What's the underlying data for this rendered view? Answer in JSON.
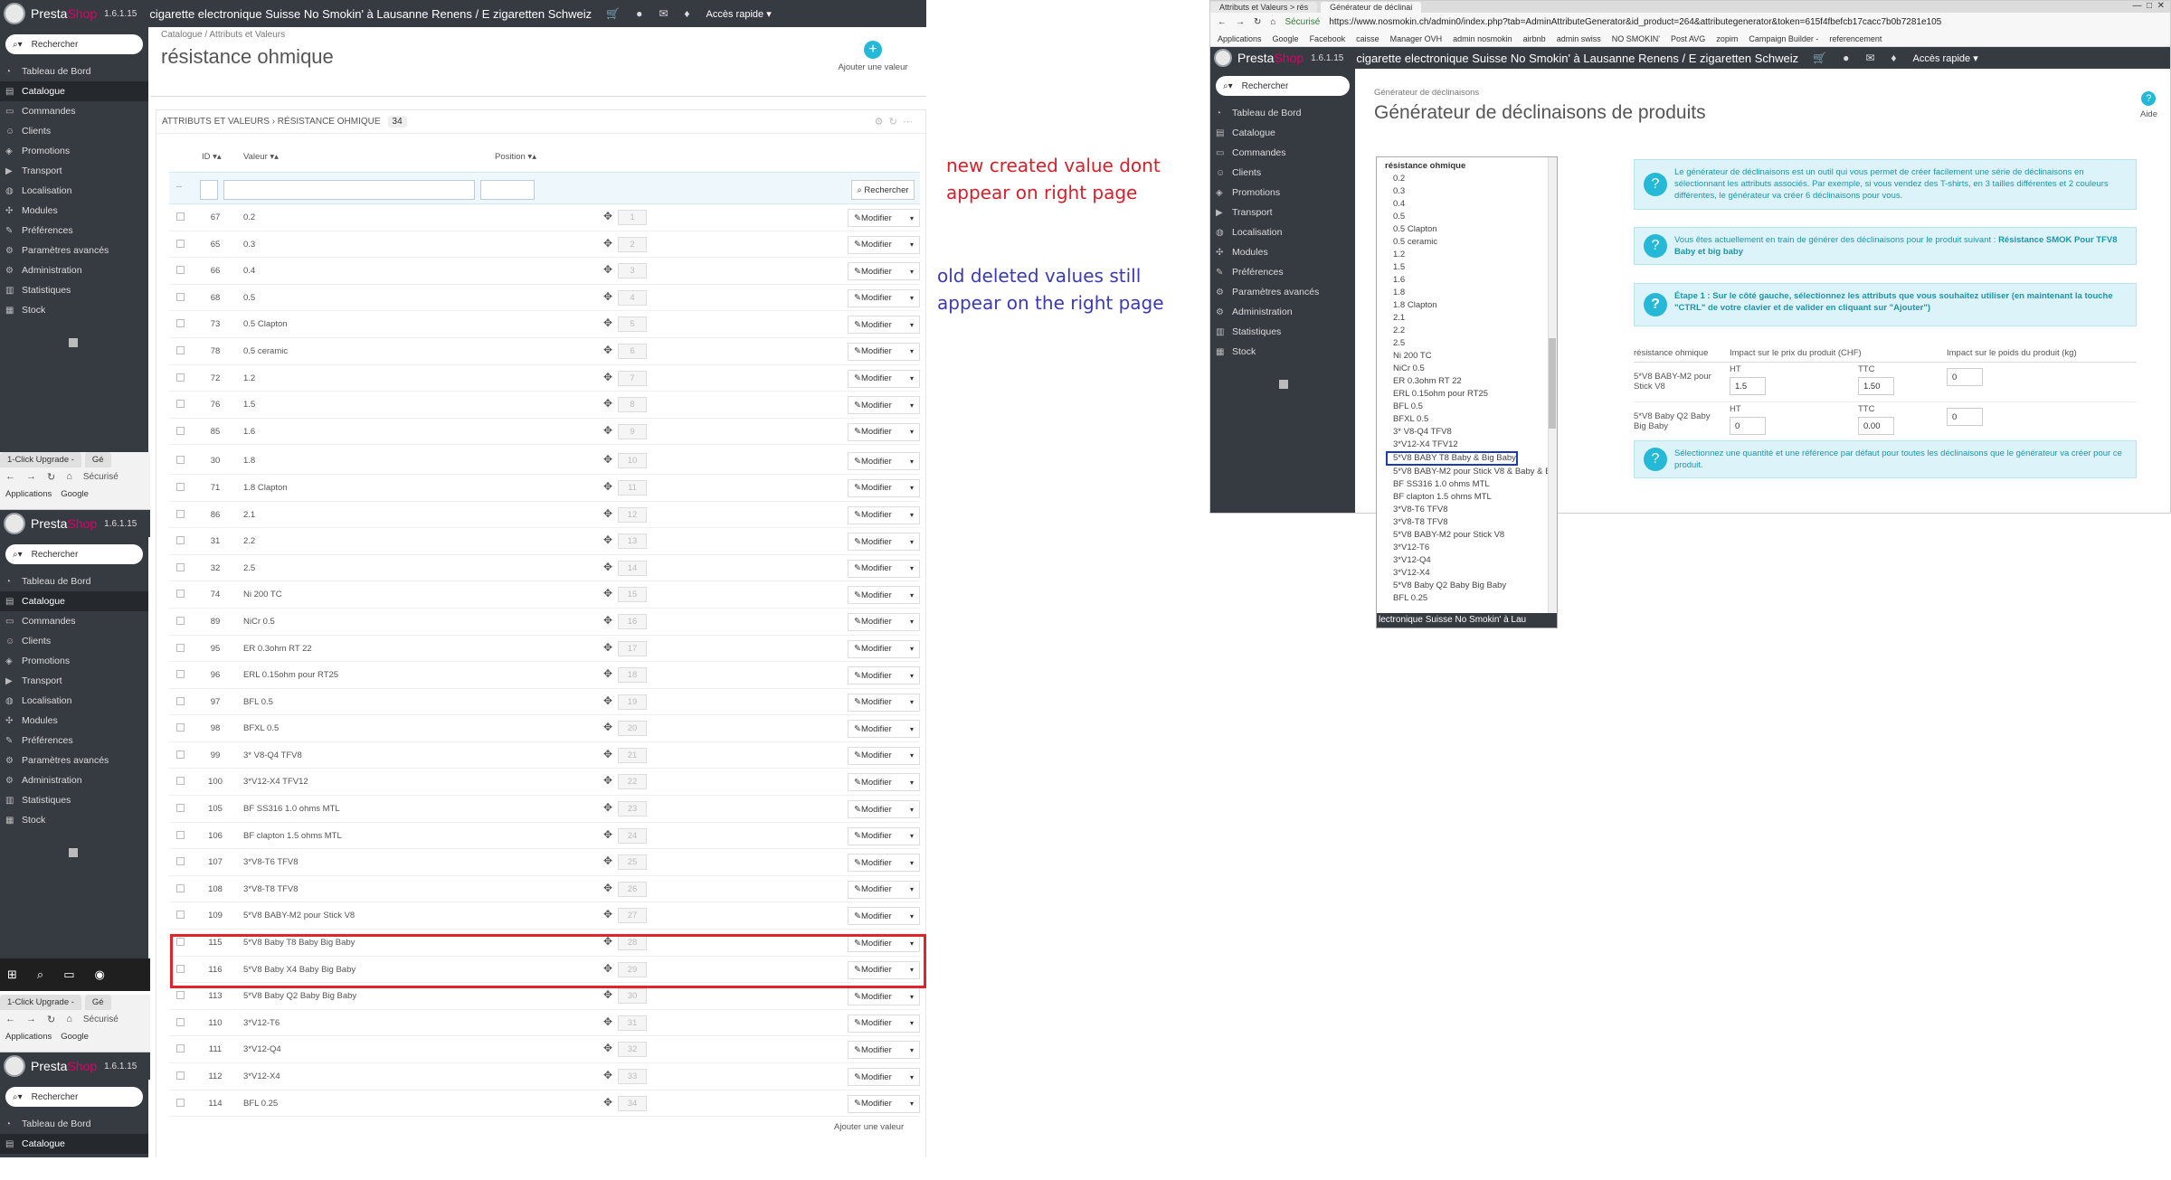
{
  "left": {
    "topbar": {
      "logo_presta": "Presta",
      "logo_shop": "Shop",
      "version": "1.6.1.15",
      "shop_name": "cigarette electronique Suisse No Smokin' à Lausanne Renens / E zigaretten Schweiz",
      "quick_access": "Accès rapide ▾"
    },
    "search_placeholder": "Rechercher",
    "menu": [
      "Tableau de Bord",
      "Catalogue",
      "Commandes",
      "Clients",
      "Promotions",
      "Transport",
      "Localisation",
      "Modules",
      "Préférences",
      "Paramètres avancés",
      "Administration",
      "Statistiques",
      "Stock"
    ],
    "browser": {
      "tab1": "1-Click Upgrade -",
      "tab2": "Gé",
      "secure": "Sécurisé",
      "apps": "Applications",
      "google": "Google"
    },
    "breadcrumb": "Catalogue  /  Attributs et Valeurs",
    "page_title": "résistance ohmique",
    "add_value_label": "Ajouter une valeur",
    "add_value_short": "A",
    "panel_title": "ATTRIBUTS ET VALEURS › RÉSISTANCE OHMIQUE",
    "count": "34",
    "columns": {
      "id": "ID ▾▴",
      "value": "Valeur ▾▴",
      "position": "Position ▾▴"
    },
    "filter_button": "Rechercher",
    "modify_label": "Modifier",
    "rows": [
      {
        "id": "67",
        "value": "0.2",
        "pos": "1"
      },
      {
        "id": "65",
        "value": "0.3",
        "pos": "2"
      },
      {
        "id": "66",
        "value": "0.4",
        "pos": "3"
      },
      {
        "id": "68",
        "value": "0.5",
        "pos": "4"
      },
      {
        "id": "73",
        "value": "0.5 Clapton",
        "pos": "5"
      },
      {
        "id": "78",
        "value": "0.5 ceramic",
        "pos": "6"
      },
      {
        "id": "72",
        "value": "1.2",
        "pos": "7"
      },
      {
        "id": "76",
        "value": "1.5",
        "pos": "8"
      },
      {
        "id": "85",
        "value": "1.6",
        "pos": "9"
      },
      {
        "id": "30",
        "value": "1.8",
        "pos": "10"
      },
      {
        "id": "71",
        "value": "1.8 Clapton",
        "pos": "11"
      },
      {
        "id": "86",
        "value": "2.1",
        "pos": "12"
      },
      {
        "id": "31",
        "value": "2.2",
        "pos": "13"
      },
      {
        "id": "32",
        "value": "2.5",
        "pos": "14"
      },
      {
        "id": "74",
        "value": "Ni 200 TC",
        "pos": "15"
      },
      {
        "id": "89",
        "value": "NiCr 0.5",
        "pos": "16"
      },
      {
        "id": "95",
        "value": "ER 0.3ohm RT 22",
        "pos": "17"
      },
      {
        "id": "96",
        "value": "ERL 0.15ohm pour RT25",
        "pos": "18"
      },
      {
        "id": "97",
        "value": "BFL 0.5",
        "pos": "19"
      },
      {
        "id": "98",
        "value": "BFXL 0.5",
        "pos": "20"
      },
      {
        "id": "99",
        "value": "3* V8-Q4 TFV8",
        "pos": "21"
      },
      {
        "id": "100",
        "value": "3*V12-X4 TFV12",
        "pos": "22"
      },
      {
        "id": "105",
        "value": "BF SS316 1.0 ohms MTL",
        "pos": "23"
      },
      {
        "id": "106",
        "value": "BF clapton 1.5 ohms MTL",
        "pos": "24"
      },
      {
        "id": "107",
        "value": "3*V8-T6 TFV8",
        "pos": "25"
      },
      {
        "id": "108",
        "value": "3*V8-T8 TFV8",
        "pos": "26"
      },
      {
        "id": "109",
        "value": "5*V8 BABY-M2 pour Stick V8",
        "pos": "27"
      },
      {
        "id": "115",
        "value": "5*V8 Baby T8 Baby Big Baby",
        "pos": "28"
      },
      {
        "id": "116",
        "value": "5*V8 Baby X4 Baby Big Baby",
        "pos": "29"
      },
      {
        "id": "113",
        "value": "5*V8 Baby Q2 Baby Big Baby",
        "pos": "30"
      },
      {
        "id": "110",
        "value": "3*V12-T6",
        "pos": "31"
      },
      {
        "id": "111",
        "value": "3*V12-Q4",
        "pos": "32"
      },
      {
        "id": "112",
        "value": "3*V12-X4",
        "pos": "33"
      },
      {
        "id": "114",
        "value": "BFL 0.25",
        "pos": "34"
      }
    ],
    "footer_add": "Ajouter une valeur"
  },
  "annotations": {
    "red_line1": "new created value dont",
    "red_line2": "appear on right page",
    "blue_line1": "old deleted values still",
    "blue_line2": "appear on the right page",
    "red_color": "#d6202b",
    "blue_color": "#3a3ab5"
  },
  "right": {
    "tabs": [
      "Attributs et Valeurs > rés",
      "Générateur de déclinai"
    ],
    "secure": "Sécurisé",
    "url": "https://www.nosmokin.ch/admin0/index.php?tab=AdminAttributeGenerator&id_product=264&attributegenerator&token=615f4fbefcb17cacc7b0b7281e105",
    "bookmarks": [
      "Applications",
      "Google",
      "Facebook",
      "caisse",
      "Manager OVH",
      "admin nosmokin",
      "airbnb",
      "admin swiss",
      "NO SMOKIN'",
      "Post AVG",
      "zopim",
      "Campaign Builder -",
      "referencement"
    ],
    "shop_name": "cigarette electronique Suisse No Smokin' à Lausanne Renens / E zigaretten Schweiz",
    "quick_access": "Accès rapide ▾",
    "menu": [
      "Tableau de Bord",
      "Catalogue",
      "Commandes",
      "Clients",
      "Promotions",
      "Transport",
      "Localisation",
      "Modules",
      "Préférences",
      "Paramètres avancés",
      "Administration",
      "Statistiques",
      "Stock"
    ],
    "breadcrumb": "Générateur de déclinaisons",
    "title": "Générateur de déclinaisons de produits",
    "aide": "Aide",
    "alert1": "Le générateur de déclinaisons est un outil qui vous permet de créer facilement une série de déclinaisons en sélectionnant les attributs associés. Par exemple, si vous vendez des T-shirts, en 3 tailles différentes et 2 couleurs différentes, le générateur va créer 6 déclinaisons pour vous.",
    "alert2_prefix": "Vous êtes actuellement en train de générer des déclinaisons pour le produit suivant :",
    "alert2_product": "Résistance SMOK Pour TFV8 Baby et big baby",
    "alert3": "Étape 1 : Sur le côté gauche, sélectionnez les attributs que vous souhaitez utiliser (en maintenant la touche \"CTRL\" de votre clavier et de valider en cliquant sur \"Ajouter\")",
    "alert4": "Sélectionnez une quantité et une référence par défaut pour toutes les déclinaisons que le générateur va créer pour ce produit.",
    "table_headers": [
      "résistance ohmique",
      "Impact sur le prix du produit (CHF)",
      "Impact sur le poids du produit (kg)"
    ],
    "ht": "HT",
    "ttc": "TTC",
    "gen_rows": [
      {
        "name": "5*V8 BABY-M2 pour Stick V8",
        "ht": "1.5",
        "ttc": "1.50",
        "weight": "0"
      },
      {
        "name": "5*V8 Baby Q2 Baby Big Baby",
        "ht": "0",
        "ttc": "0.00",
        "weight": "0"
      }
    ],
    "listbox": {
      "header": "résistance ohmique",
      "items": [
        "0.2",
        "0.3",
        "0.4",
        "0.5",
        "0.5 Clapton",
        "0.5 ceramic",
        "1.2",
        "1.5",
        "1.6",
        "1.8",
        "1.8 Clapton",
        "2.1",
        "2.2",
        "2.5",
        "Ni 200 TC",
        "NiCr 0.5",
        "ER 0.3ohm RT 22",
        "ERL 0.15ohm pour RT25",
        "BFL 0.5",
        "BFXL 0.5",
        "3* V8-Q4 TFV8",
        "3*V12-X4 TFV12"
      ],
      "selected": "5*V8 BABY T8 Baby & Big Baby",
      "items_after": [
        "5*V8 BABY-M2 pour Stick V8 & Baby & E",
        "BF SS316 1.0 ohms MTL",
        "BF clapton 1.5 ohms MTL",
        "3*V8-T6 TFV8",
        "3*V8-T8 TFV8",
        "5*V8 BABY-M2 pour Stick V8",
        "3*V12-T6",
        "3*V12-Q4",
        "3*V12-X4",
        "5*V8 Baby Q2 Baby Big Baby",
        "BFL 0.25"
      ],
      "footer": "lectronique Suisse No Smokin' à Lau"
    }
  }
}
